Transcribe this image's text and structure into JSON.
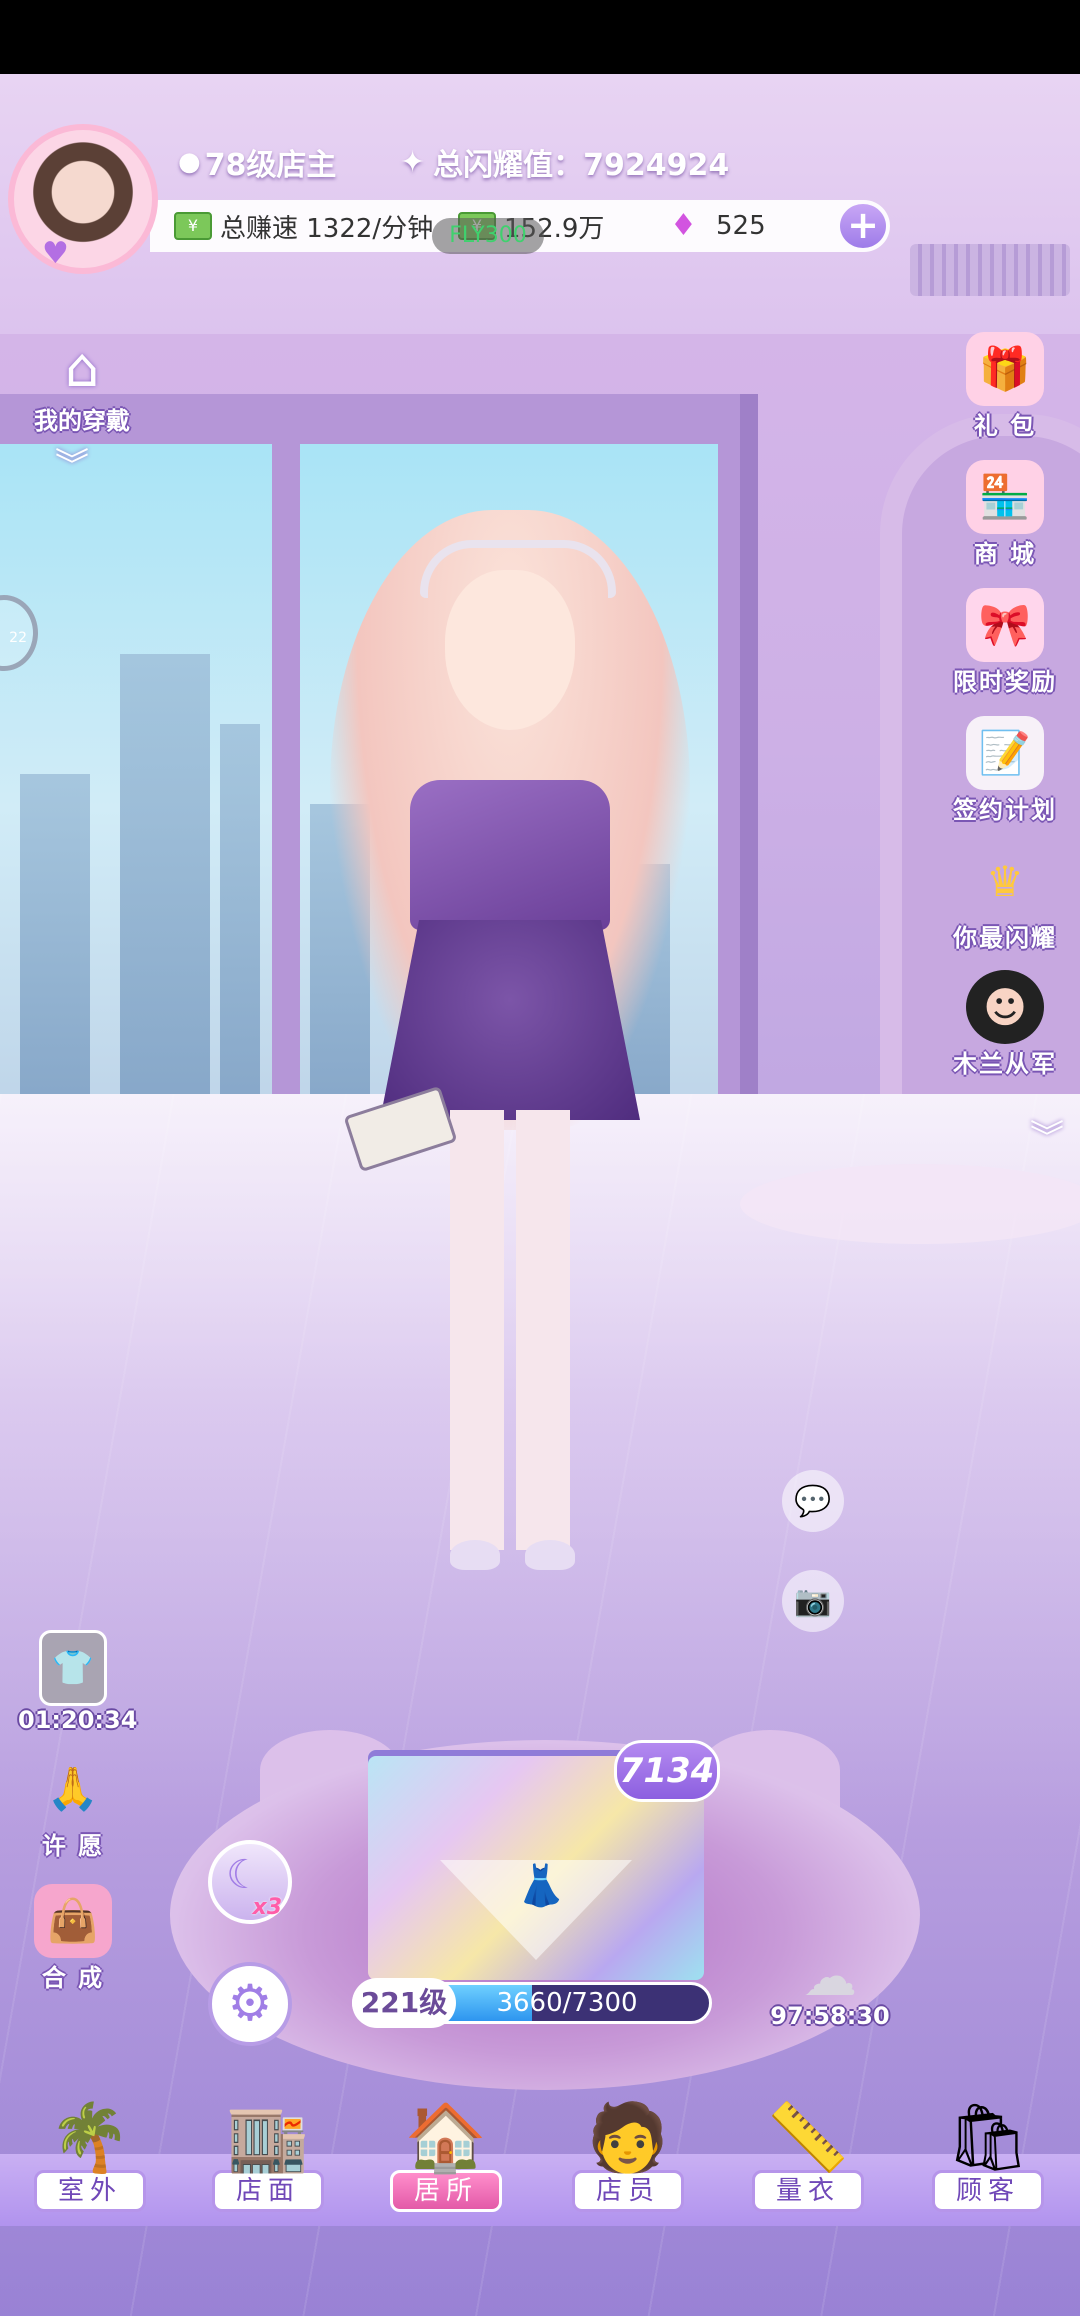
{
  "header": {
    "level_label": "78级店主",
    "total_shine": "总闪耀值：7924924",
    "earn_rate": "总赚速 1322/分钟",
    "money": "152.9万",
    "gems": "525",
    "plus_icon": "plus-icon",
    "floating_fly_text": "FLY300"
  },
  "left_panel": {
    "wardrobe_label": "我的穿戴",
    "edge_text": "22",
    "timer": "01:20:34",
    "wish_label": "许 愿",
    "combine_label": "合 成"
  },
  "right_panel": {
    "items": [
      {
        "label": "礼 包",
        "icon": "gift-icon"
      },
      {
        "label": "商 城",
        "icon": "shop-icon"
      },
      {
        "label": "限时奖励",
        "icon": "reward-box-icon"
      },
      {
        "label": "签约计划",
        "icon": "contract-icon"
      },
      {
        "label": "你最闪耀",
        "icon": "crown-icon"
      },
      {
        "label": "木兰从军",
        "icon": "mulan-avatar-icon"
      }
    ]
  },
  "mystery_box": {
    "count": "7134",
    "level": "221级",
    "progress_text": "3660/7300",
    "progress_value": 0.5014,
    "multiplier": "x3",
    "cloud_timer": "97:58:30"
  },
  "nav": {
    "items": [
      {
        "label": "室外",
        "icon": "palm-tree-icon",
        "active": false
      },
      {
        "label": "店面",
        "icon": "storefront-icon",
        "active": false
      },
      {
        "label": "居所",
        "icon": "house-icon",
        "active": true
      },
      {
        "label": "店员",
        "icon": "clerk-avatar-icon",
        "active": false
      },
      {
        "label": "量衣",
        "icon": "measuring-tape-icon",
        "active": false
      },
      {
        "label": "顾客",
        "icon": "shopping-bag-icon",
        "active": false
      }
    ]
  },
  "colors": {
    "accent": "#9e7ce9",
    "active_nav": "#e35aa8",
    "progress": "#2d95ef"
  }
}
